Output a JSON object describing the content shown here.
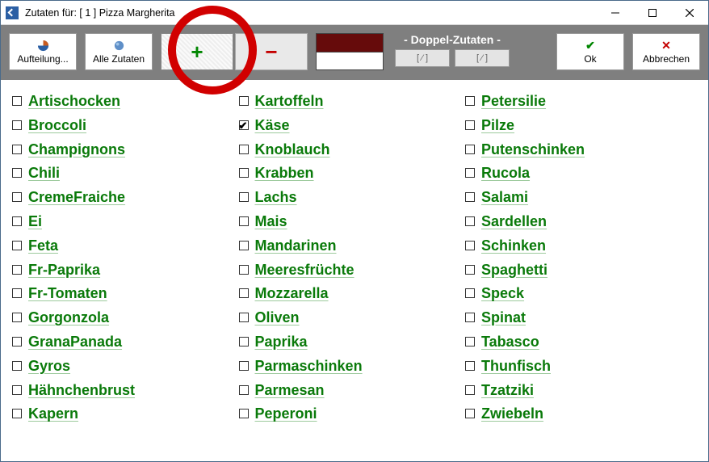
{
  "window": {
    "title": "Zutaten für: [ 1 ]  Pizza Margherita"
  },
  "toolbar": {
    "aufteilung": "Aufteilung...",
    "alleZutaten": "Alle Zutaten",
    "doppelZutaten": "- Doppel-Zutaten -",
    "dzLeft": "[  ⁄  ]",
    "dzRight": "[  ⁄  ]",
    "ok": "Ok",
    "cancel": "Abbrechen"
  },
  "ingredients": {
    "col1": [
      {
        "label": "Artischocken",
        "checked": false
      },
      {
        "label": "Broccoli",
        "checked": false
      },
      {
        "label": "Champignons",
        "checked": false
      },
      {
        "label": "Chili",
        "checked": false
      },
      {
        "label": "CremeFraiche",
        "checked": false
      },
      {
        "label": "Ei",
        "checked": false
      },
      {
        "label": "Feta",
        "checked": false
      },
      {
        "label": "Fr-Paprika",
        "checked": false
      },
      {
        "label": "Fr-Tomaten",
        "checked": false
      },
      {
        "label": "Gorgonzola",
        "checked": false
      },
      {
        "label": "GranaPanada",
        "checked": false
      },
      {
        "label": "Gyros",
        "checked": false
      },
      {
        "label": "Hähnchenbrust",
        "checked": false
      },
      {
        "label": "Kapern",
        "checked": false
      }
    ],
    "col2": [
      {
        "label": "Kartoffeln",
        "checked": false
      },
      {
        "label": "Käse",
        "checked": true
      },
      {
        "label": "Knoblauch",
        "checked": false
      },
      {
        "label": "Krabben",
        "checked": false
      },
      {
        "label": "Lachs",
        "checked": false
      },
      {
        "label": "Mais",
        "checked": false
      },
      {
        "label": "Mandarinen",
        "checked": false
      },
      {
        "label": "Meeresfrüchte",
        "checked": false
      },
      {
        "label": "Mozzarella",
        "checked": false
      },
      {
        "label": "Oliven",
        "checked": false
      },
      {
        "label": "Paprika",
        "checked": false
      },
      {
        "label": "Parmaschinken",
        "checked": false
      },
      {
        "label": "Parmesan",
        "checked": false
      },
      {
        "label": "Peperoni",
        "checked": false
      }
    ],
    "col3": [
      {
        "label": "Petersilie",
        "checked": false
      },
      {
        "label": "Pilze",
        "checked": false
      },
      {
        "label": "Putenschinken",
        "checked": false
      },
      {
        "label": "Rucola",
        "checked": false
      },
      {
        "label": "Salami",
        "checked": false
      },
      {
        "label": "Sardellen",
        "checked": false
      },
      {
        "label": "Schinken",
        "checked": false
      },
      {
        "label": "Spaghetti",
        "checked": false
      },
      {
        "label": "Speck",
        "checked": false
      },
      {
        "label": "Spinat",
        "checked": false
      },
      {
        "label": "Tabasco",
        "checked": false
      },
      {
        "label": "Thunfisch",
        "checked": false
      },
      {
        "label": "Tzatziki",
        "checked": false
      },
      {
        "label": "Zwiebeln",
        "checked": false
      }
    ]
  }
}
